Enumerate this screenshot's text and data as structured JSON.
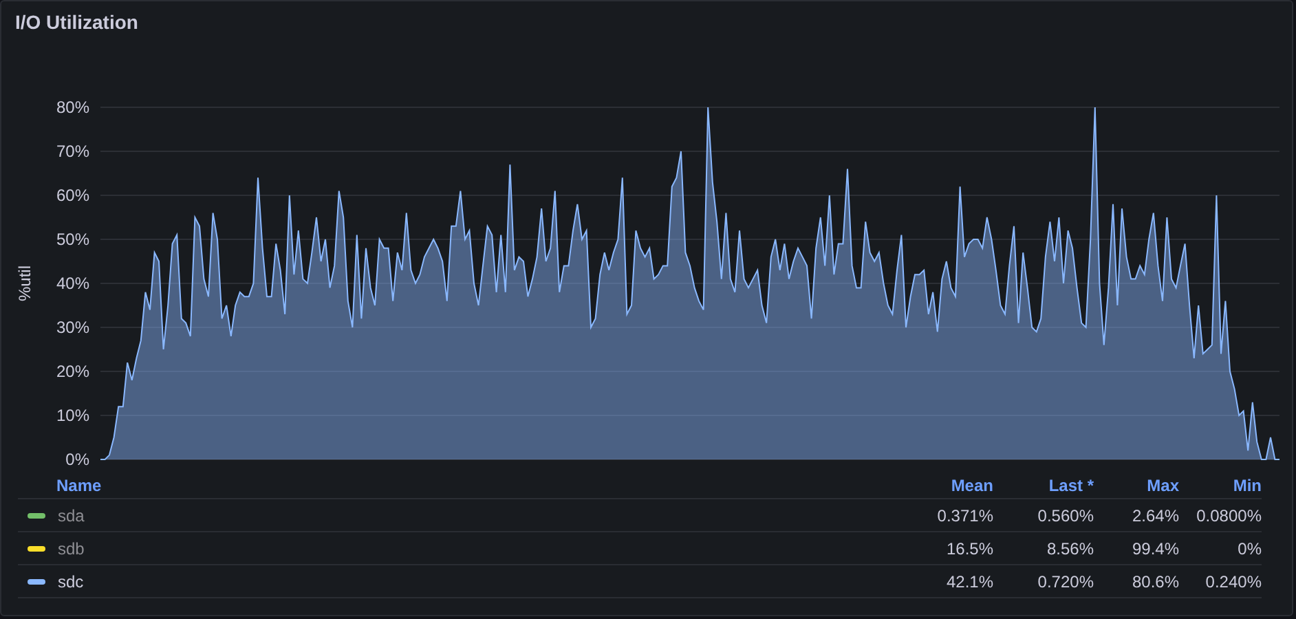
{
  "panel": {
    "title": "I/O Utilization"
  },
  "chart_data": {
    "type": "area",
    "ylabel": "%util",
    "grid": true,
    "ylim": [
      0,
      80
    ],
    "yticks": [
      {
        "value": 0,
        "label": "0%"
      },
      {
        "value": 10,
        "label": "10%"
      },
      {
        "value": 20,
        "label": "20%"
      },
      {
        "value": 30,
        "label": "30%"
      },
      {
        "value": 40,
        "label": "40%"
      },
      {
        "value": 50,
        "label": "50%"
      },
      {
        "value": 60,
        "label": "60%"
      },
      {
        "value": 70,
        "label": "70%"
      },
      {
        "value": 80,
        "label": "80%"
      }
    ],
    "series": [
      {
        "color": "#8ab8ff",
        "values": [
          0,
          0,
          1,
          5,
          12,
          12,
          22,
          18,
          23,
          27,
          38,
          34,
          47,
          45,
          25,
          35,
          49,
          51,
          32,
          31,
          28,
          55,
          53,
          41,
          37,
          56,
          50,
          32,
          35,
          28,
          35,
          38,
          37,
          37,
          40,
          64,
          48,
          37,
          37,
          49,
          43,
          33,
          60,
          42,
          52,
          41,
          40,
          47,
          55,
          45,
          50,
          39,
          44,
          61,
          55,
          36,
          30,
          51,
          32,
          48,
          39,
          35,
          50,
          48,
          48,
          36,
          47,
          43,
          56,
          43,
          40,
          42,
          46,
          48,
          50,
          48,
          45,
          36,
          53,
          53,
          61,
          50,
          52,
          40,
          35,
          44,
          53,
          51,
          38,
          51,
          38,
          67,
          43,
          46,
          45,
          37,
          41,
          46,
          57,
          45,
          48,
          61,
          38,
          44,
          44,
          52,
          58,
          50,
          52,
          30,
          32,
          42,
          47,
          43,
          47,
          50,
          64,
          33,
          35,
          52,
          48,
          46,
          48,
          41,
          42,
          44,
          44,
          62,
          64,
          70,
          47,
          44,
          39,
          36,
          34,
          80,
          63,
          54,
          41,
          56,
          41,
          38,
          52,
          41,
          39,
          41,
          43,
          35,
          31,
          46,
          50,
          43,
          49,
          41,
          45,
          48,
          46,
          44,
          32,
          48,
          55,
          44,
          60,
          42,
          49,
          49,
          66,
          44,
          39,
          39,
          54,
          47,
          45,
          47,
          40,
          35,
          33,
          43,
          51,
          30,
          37,
          42,
          42,
          43,
          33,
          38,
          29,
          41,
          45,
          39,
          37,
          62,
          46,
          49,
          50,
          50,
          48,
          55,
          50,
          43,
          35,
          33,
          44,
          53,
          31,
          47,
          39,
          30,
          29,
          32,
          46,
          54,
          45,
          55,
          40,
          52,
          48,
          39,
          31,
          30,
          50,
          80,
          40,
          26,
          39,
          58,
          35,
          57,
          46,
          41,
          41,
          44,
          42,
          50,
          56,
          44,
          36,
          55,
          41,
          39,
          44,
          49,
          35,
          23,
          35,
          24,
          25,
          26,
          60,
          24,
          36,
          20,
          16,
          10,
          11,
          2,
          13,
          4,
          0,
          0,
          5,
          0,
          0
        ]
      }
    ]
  },
  "legend": {
    "columns": [
      "Name",
      "Mean",
      "Last *",
      "Max",
      "Min"
    ],
    "rows": [
      {
        "color": "#73bf69",
        "hidden": true,
        "cells": [
          "sda",
          "0.371%",
          "0.560%",
          "2.64%",
          "0.0800%"
        ]
      },
      {
        "color": "#fade2a",
        "hidden": true,
        "cells": [
          "sdb",
          "16.5%",
          "8.56%",
          "99.4%",
          "0%"
        ]
      },
      {
        "color": "#8ab8ff",
        "hidden": false,
        "cells": [
          "sdc",
          "42.1%",
          "0.720%",
          "80.6%",
          "0.240%"
        ]
      }
    ]
  }
}
